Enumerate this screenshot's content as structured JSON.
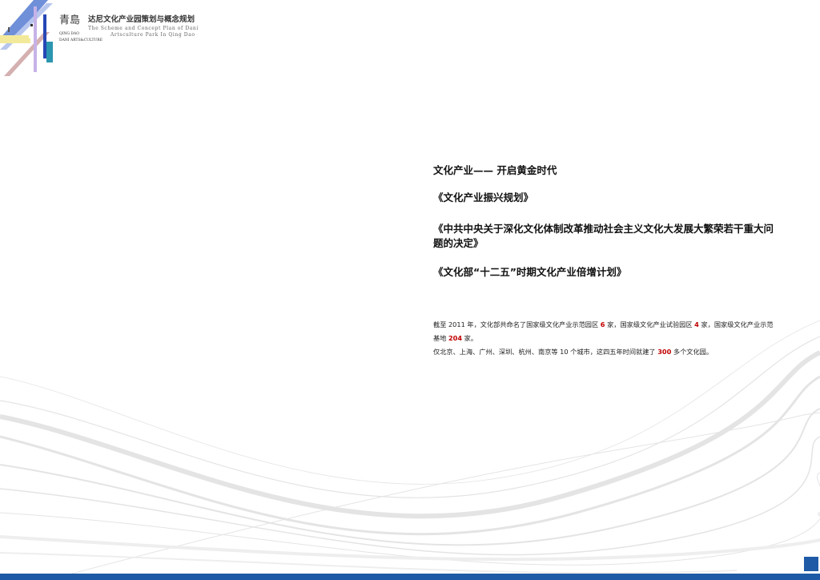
{
  "header": {
    "logo_cn": "青島",
    "logo_pinyin_1": "QING DAO",
    "logo_pinyin_2": "DANI ARTS&CULTURE",
    "project_title_cn": "达尼文化产业园策划与概念规划",
    "project_title_en_1": "The Scheme and Concept Plan of Dani",
    "project_title_en_2": "Artsculture Park In Qing Dao"
  },
  "content": {
    "heading_1": "文化产业—— 开启黄金时代",
    "heading_2": "《文化产业振兴规划》",
    "heading_3": "《中共中央关于深化文化体制改革推动社会主义文化大发展大繁荣若干重大问题的决定》",
    "heading_4": "《文化部“十二五”时期文化产业倍增计划》",
    "paragraph": {
      "p1_a": "截至 2011 年，文化部共命名了国家级文化产业示范园区 ",
      "p1_num_1": "6",
      "p1_b": " 家，国家级文化产业试验园区 ",
      "p1_num_2": "4",
      "p1_c": " 家，国家级文化产业示范基地 ",
      "p1_num_3": "204",
      "p1_d": " 家。",
      "p2_a": "仅北京、上海、广州、深圳、杭州、南京等 10 个城市，这四五年时间就建了 ",
      "p2_num": "300",
      "p2_b": " 多个文化园。"
    }
  },
  "colors": {
    "accent_blue": "#1f5aa6",
    "highlight_red": "#c00000"
  }
}
